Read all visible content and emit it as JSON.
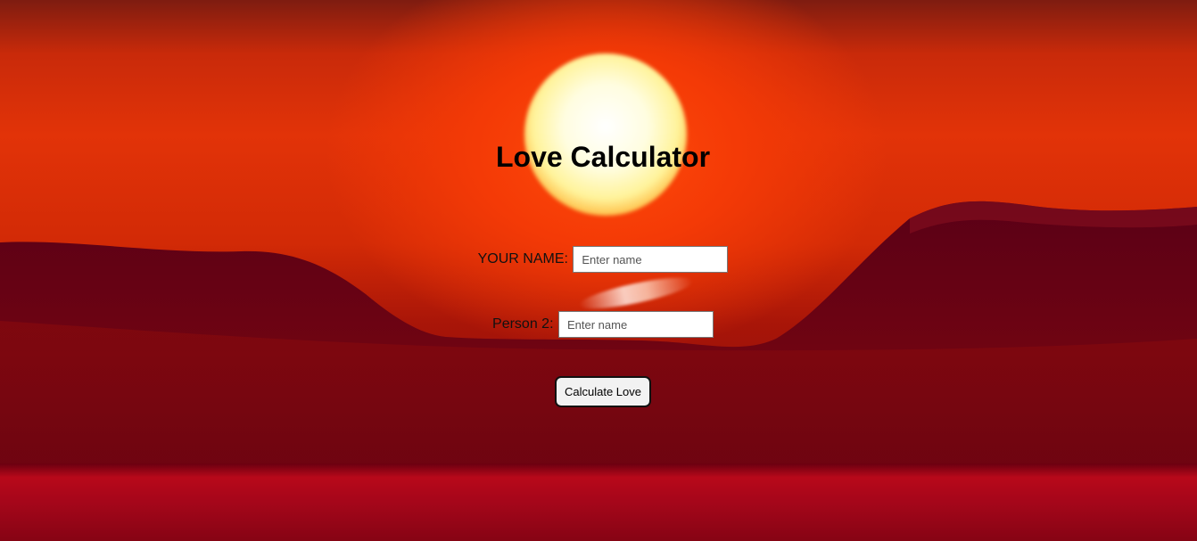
{
  "page": {
    "title": "Love Calculator"
  },
  "form": {
    "your_name_label": "YOUR NAME:",
    "your_name_placeholder": "Enter name",
    "your_name_value": "",
    "person2_label": "Person 2:",
    "person2_placeholder": "Enter name",
    "person2_value": "",
    "submit_label": "Calculate Love"
  },
  "theme": {
    "background": "sunset over red mountains",
    "text_color": "#000000",
    "button_bg": "#f2f2f2"
  }
}
